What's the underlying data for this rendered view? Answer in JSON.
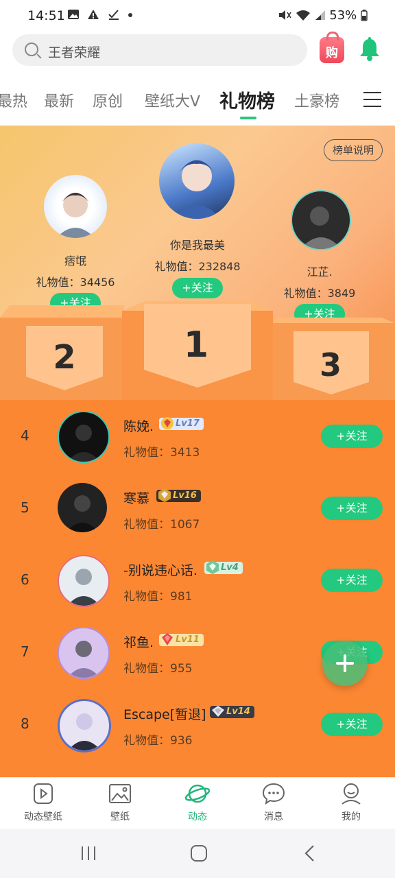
{
  "status_bar": {
    "time": "14:51",
    "icons": [
      "image-icon",
      "warning-icon",
      "check-icon",
      "dot-icon"
    ],
    "battery": "53%"
  },
  "search": {
    "placeholder": "王者荣耀"
  },
  "shop_icon_label": "购",
  "tabs": [
    {
      "label": "最热"
    },
    {
      "label": "最新"
    },
    {
      "label": "原创"
    },
    {
      "label": "壁纸大V"
    },
    {
      "label": "礼物榜",
      "active": true
    },
    {
      "label": "土豪榜"
    }
  ],
  "podium": {
    "rules_label": "榜单说明",
    "first": {
      "rank": "1",
      "name": "你是我最美",
      "gift": "礼物值：232848",
      "follow": "+关注"
    },
    "second": {
      "rank": "2",
      "name": "痞氓",
      "gift": "礼物值：34456",
      "follow": "+关注"
    },
    "third": {
      "rank": "3",
      "name": "江芷.",
      "gift": "礼物值：3849",
      "follow": "+关注"
    }
  },
  "list": [
    {
      "rank": "4",
      "name": "陈娩.",
      "level": "Lv17",
      "gift": "礼物值：3413",
      "follow": "+关注"
    },
    {
      "rank": "5",
      "name": "寒慕",
      "level": "Lv16",
      "gift": "礼物值：1067",
      "follow": "+关注"
    },
    {
      "rank": "6",
      "name": "-别说违心话.",
      "level": "Lv4",
      "gift": "礼物值：981",
      "follow": "+关注"
    },
    {
      "rank": "7",
      "name": "祁鱼.",
      "level": "Lv11",
      "gift": "礼物值：955",
      "follow": "+关注"
    },
    {
      "rank": "8",
      "name": "Escape[暂退]",
      "level": "Lv14",
      "gift": "礼物值：936",
      "follow": "+关注"
    }
  ],
  "bottom_nav": [
    {
      "label": "动态壁纸",
      "icon": "play-icon"
    },
    {
      "label": "壁纸",
      "icon": "image-icon"
    },
    {
      "label": "动态",
      "icon": "planet-icon",
      "active": true
    },
    {
      "label": "消息",
      "icon": "chat-icon"
    },
    {
      "label": "我的",
      "icon": "profile-icon"
    }
  ],
  "colors": {
    "accent": "#23c97e",
    "list_bg": "#fb8733",
    "podium": "#f89a50"
  }
}
